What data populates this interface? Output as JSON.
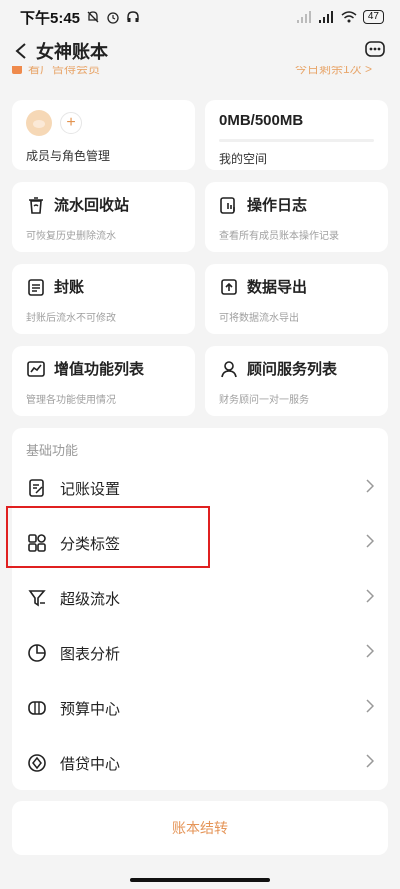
{
  "status": {
    "time": "下午5:45",
    "battery": "47"
  },
  "nav": {
    "title": "女神账本"
  },
  "promo": {
    "left": "看广告得会员",
    "right": "今日剩余1次 >"
  },
  "member": {
    "label": "成员与角色管理"
  },
  "space": {
    "value": "0MB/500MB",
    "label": "我的空间"
  },
  "tiles": [
    {
      "title": "流水回收站",
      "sub": "可恢复历史删除流水",
      "icon": "trash-restore-icon"
    },
    {
      "title": "操作日志",
      "sub": "查看所有成员账本操作记录",
      "icon": "operation-log-icon"
    },
    {
      "title": "封账",
      "sub": "封账后流水不可修改",
      "icon": "lock-account-icon"
    },
    {
      "title": "数据导出",
      "sub": "可将数据流水导出",
      "icon": "export-icon"
    },
    {
      "title": "增值功能列表",
      "sub": "管理各功能使用情况",
      "icon": "chart-up-icon"
    },
    {
      "title": "顾问服务列表",
      "sub": "财务顾问一对一服务",
      "icon": "advisor-icon"
    }
  ],
  "basic": {
    "title": "基础功能",
    "items": [
      {
        "label": "记账设置",
        "icon": "bookkeeping-settings-icon"
      },
      {
        "label": "分类标签",
        "icon": "category-tags-icon"
      },
      {
        "label": "超级流水",
        "icon": "super-flow-icon"
      },
      {
        "label": "图表分析",
        "icon": "pie-chart-icon"
      },
      {
        "label": "预算中心",
        "icon": "budget-icon"
      },
      {
        "label": "借贷中心",
        "icon": "loan-icon"
      }
    ]
  },
  "footer": {
    "settle": "账本结转"
  }
}
